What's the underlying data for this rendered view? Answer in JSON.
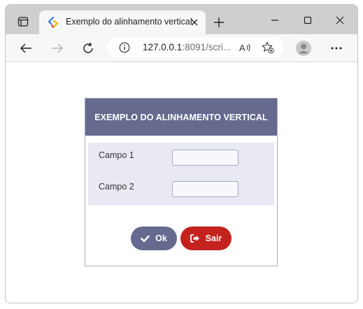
{
  "browser": {
    "tab": {
      "title": "Exemplo do alinhamento vertical",
      "favicon": "code-favicon-icon"
    },
    "address": {
      "host": "127.0.0.1",
      "rest": ":8091/scri..."
    }
  },
  "page": {
    "panel_title": "EXEMPLO DO ALINHAMENTO VERTICAL",
    "fields": [
      {
        "label": "Campo 1",
        "value": ""
      },
      {
        "label": "Campo 2",
        "value": ""
      }
    ],
    "buttons": {
      "ok_label": "Ok",
      "sair_label": "Sair"
    }
  },
  "colors": {
    "header": "#656a8e",
    "form_bg": "#e9e9f4",
    "ok_button": "#656a8e",
    "sair_button": "#c4221f"
  }
}
